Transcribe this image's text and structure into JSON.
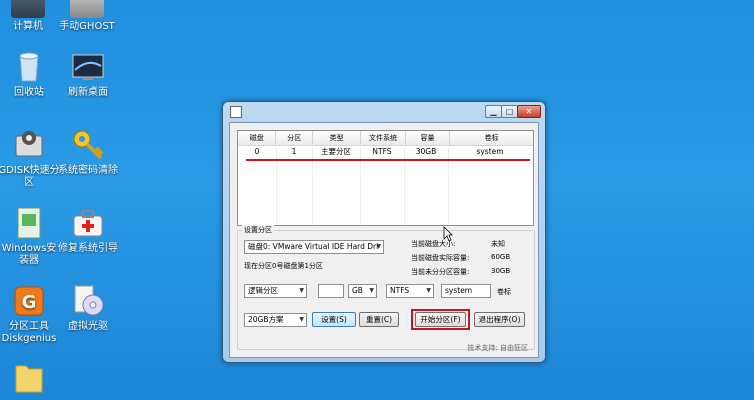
{
  "desktop": {
    "icons": [
      {
        "label": "计算机"
      },
      {
        "label": "手动GHOST"
      },
      {
        "label": "回收站"
      },
      {
        "label": "刷新桌面"
      },
      {
        "label": "GDISK快速分区"
      },
      {
        "label": "系统密码清除"
      },
      {
        "label": "Windows安装器"
      },
      {
        "label": "修复系统引导"
      },
      {
        "label": "分区工具Diskgenius"
      },
      {
        "label": "虚拟光驱"
      }
    ]
  },
  "window": {
    "controls": {
      "minimize": "▁",
      "maximize": "□",
      "close": "✕"
    },
    "table": {
      "headers": [
        "磁盘",
        "分区",
        "类型",
        "文件系统",
        "容量",
        "卷标"
      ],
      "rows": [
        [
          "0",
          "1",
          "主要分区",
          "NTFS",
          "30GB",
          "system"
        ]
      ]
    },
    "settings": {
      "group_title": "设置分区",
      "disk_select": "磁盘0: VMware Virtual IDE Hard Dri",
      "current_info": "现在分区0号磁盘第1分区",
      "stats": [
        {
          "label": "当前磁盘大小:",
          "value": "未知"
        },
        {
          "label": "当前磁盘实际容量:",
          "value": "60GB"
        },
        {
          "label": "当前未分分区容量:",
          "value": "30GB"
        }
      ],
      "type_select": "逻辑分区",
      "size_value": "",
      "unit_select": "GB",
      "fs_select": "NTFS",
      "volume_label": "system",
      "volume_label_caption": "卷标",
      "scheme_select": "20GB方案",
      "buttons": {
        "set": "设置(S)",
        "reset": "重置(C)",
        "start": "开始分区(F)",
        "exit": "退出程序(O)"
      }
    },
    "footer": "技术支持: 自由狂区"
  },
  "colors": {
    "desktop_bg": "#2a9be6",
    "highlight_red": "#c8141c"
  }
}
